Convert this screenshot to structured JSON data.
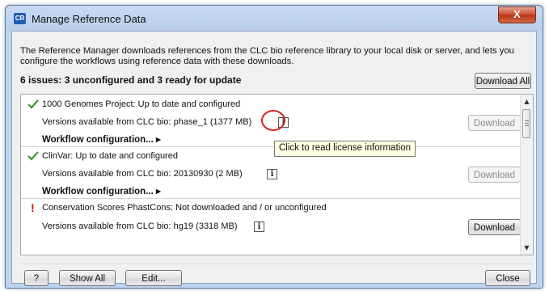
{
  "window": {
    "app_icon_text": "CR",
    "title": "Manage Reference Data",
    "close_glyph": "X"
  },
  "intro_text": "The Reference Manager downloads references from the CLC bio reference library to your local disk or server, and lets you configure the workflows using reference data with these downloads.",
  "issues_summary": "6 issues: 3 unconfigured and 3 ready for update",
  "download_all_label": "Download All",
  "items": [
    {
      "status_icon": "check-icon",
      "status_text": "1000 Genomes Project: Up to date and configured",
      "versions_text": "Versions available from CLC bio: phase_1 (1377 MB)",
      "info_glyph": "i",
      "download_label": "Download",
      "download_enabled": false,
      "workflow_label": "Workflow configuration...",
      "workflow_arrow": "▸"
    },
    {
      "status_icon": "check-icon",
      "status_text": "ClinVar: Up to date and configured",
      "versions_text": "Versions available from CLC bio: 20130930 (2 MB)",
      "info_glyph": "i",
      "download_label": "Download",
      "download_enabled": false,
      "workflow_label": "Workflow configuration...",
      "workflow_arrow": "▸"
    },
    {
      "status_icon": "warning-exclamation-icon",
      "status_glyph": "!",
      "status_text": "Conservation Scores PhastCons: Not downloaded and / or unconfigured",
      "versions_text": "Versions available from CLC bio: hg19 (3318 MB)",
      "info_glyph": "i",
      "download_label": "Download",
      "download_enabled": true
    }
  ],
  "tooltip_text": "Click to read license information",
  "footer": {
    "help_label": "?",
    "show_all_label": "Show All",
    "edit_label": "Edit...",
    "close_label": "Close"
  },
  "colors": {
    "check_green": "#3a9a2a",
    "warning_red": "#e00000",
    "callout_red": "#d82020",
    "tooltip_bg": "#ffffe1"
  }
}
